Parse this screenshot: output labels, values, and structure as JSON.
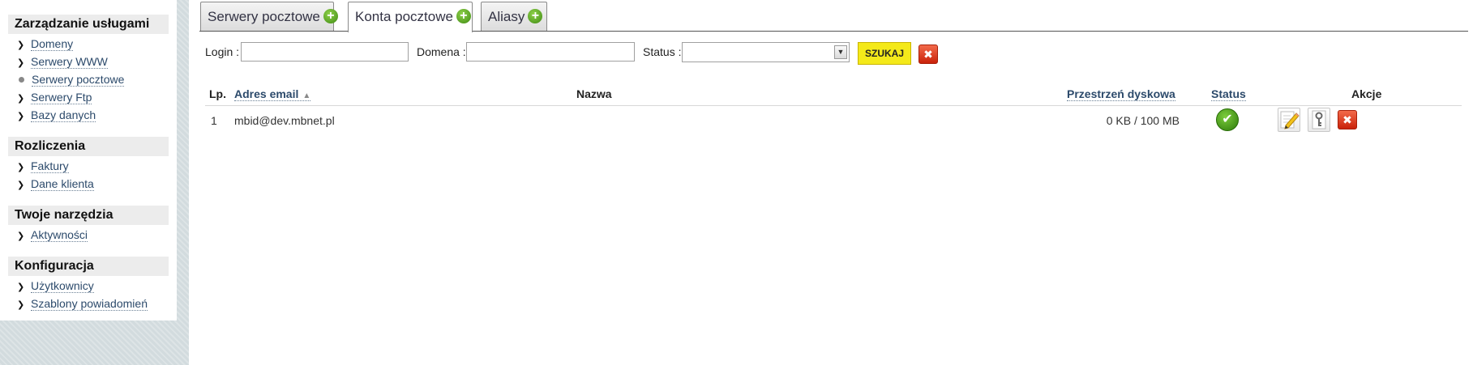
{
  "sidebar": {
    "sections": [
      {
        "title": "Zarządzanie usługami",
        "items": [
          {
            "label": "Domeny",
            "icon": "arrow-icon"
          },
          {
            "label": "Serwery WWW",
            "icon": "arrow-icon"
          },
          {
            "label": "Serwery pocztowe",
            "icon": "bullet-icon"
          },
          {
            "label": "Serwery Ftp",
            "icon": "arrow-icon"
          },
          {
            "label": "Bazy danych",
            "icon": "arrow-icon"
          }
        ]
      },
      {
        "title": "Rozliczenia",
        "items": [
          {
            "label": "Faktury",
            "icon": "arrow-icon"
          },
          {
            "label": "Dane klienta",
            "icon": "arrow-icon"
          }
        ]
      },
      {
        "title": "Twoje narzędzia",
        "items": [
          {
            "label": "Aktywności",
            "icon": "arrow-icon"
          }
        ]
      },
      {
        "title": "Konfiguracja",
        "items": [
          {
            "label": "Użytkownicy",
            "icon": "arrow-icon"
          },
          {
            "label": "Szablony powiadomień",
            "icon": "arrow-icon"
          }
        ]
      }
    ]
  },
  "tabs": [
    {
      "label": "Serwery pocztowe",
      "active": false
    },
    {
      "label": "Konta pocztowe",
      "active": true
    },
    {
      "label": "Aliasy",
      "active": false
    }
  ],
  "filter": {
    "login_label": "Login :",
    "login_value": "",
    "domain_label": "Domena :",
    "domain_value": "",
    "status_label": "Status :",
    "status_value": "",
    "search_label": "SZUKAJ"
  },
  "table": {
    "headers": {
      "lp": "Lp.",
      "email": "Adres email",
      "name": "Nazwa",
      "space": "Przestrzeń dyskowa",
      "status": "Status",
      "actions": "Akcje"
    },
    "rows": [
      {
        "lp": "1",
        "email": "mbid@dev.mbnet.pl",
        "name": "",
        "space": "0 KB / 100 MB",
        "status": "active"
      }
    ]
  },
  "colors": {
    "accent_link": "#2c4a6b",
    "search_button": "#f4e91a",
    "delete_red": "#d9341a",
    "ok_green": "#3e9a1a"
  }
}
